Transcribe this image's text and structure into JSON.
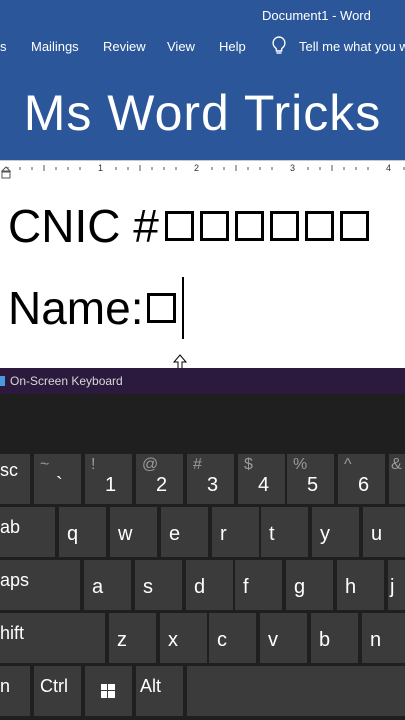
{
  "window": {
    "title": "Document1  -  Word"
  },
  "ribbon": {
    "tabs": [
      "s",
      "Mailings",
      "Review",
      "View",
      "Help"
    ],
    "tell_me": "Tell me what you wa"
  },
  "banner": {
    "text": "Ms Word Tricks"
  },
  "ruler": {
    "numbers": [
      "1",
      "1",
      "2",
      "3",
      "4"
    ]
  },
  "document": {
    "line1": "CNIC # ",
    "line2": "Name: "
  },
  "keyboard": {
    "title": "On-Screen Keyboard",
    "row1": [
      {
        "shift": "",
        "main": "sc"
      },
      {
        "shift": "~",
        "main": "`"
      },
      {
        "shift": "!",
        "main": "1"
      },
      {
        "shift": "@",
        "main": "2"
      },
      {
        "shift": "#",
        "main": "3"
      },
      {
        "shift": "$",
        "main": "4"
      },
      {
        "shift": "%",
        "main": "5"
      },
      {
        "shift": "^",
        "main": "6"
      },
      {
        "shift": "&",
        "main": ""
      }
    ],
    "row2": [
      "ab",
      "q",
      "w",
      "e",
      "r",
      "t",
      "y",
      "u"
    ],
    "row3": [
      "aps",
      "a",
      "s",
      "d",
      "f",
      "g",
      "h",
      "j"
    ],
    "row4": [
      "hift",
      "z",
      "x",
      "c",
      "v",
      "b",
      "n"
    ],
    "row5": [
      "n",
      "Ctrl",
      "",
      "Alt"
    ]
  },
  "colors": {
    "ribbon": "#2b579a",
    "osk_title": "#2b1a3d",
    "key": "#3b3b3b"
  }
}
